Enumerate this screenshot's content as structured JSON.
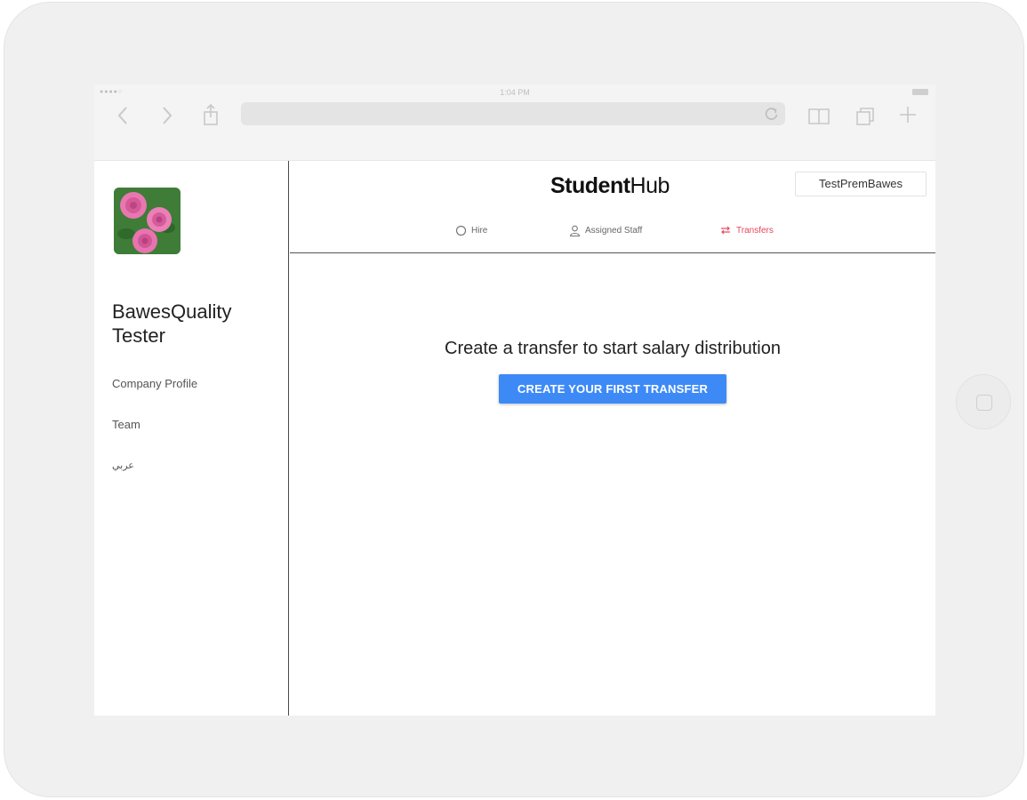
{
  "browser": {
    "status_time": "1:04 PM",
    "status_signal": "●●●●○",
    "icons": [
      "back-icon",
      "forward-icon",
      "share-icon",
      "reload-icon",
      "bookmarks-icon",
      "tabs-icon",
      "new-tab-icon"
    ]
  },
  "sidebar": {
    "company_name": "BawesQuality Tester",
    "links": [
      {
        "label": "Company Profile"
      },
      {
        "label": "Team"
      },
      {
        "label": "عربي"
      }
    ]
  },
  "header": {
    "logo_bold": "Student",
    "logo_light": "Hub",
    "user_label": "TestPremBawes",
    "tabs": [
      {
        "label": "Hire",
        "icon": "circle-icon",
        "active": false
      },
      {
        "label": "Assigned Staff",
        "icon": "person-icon",
        "active": false
      },
      {
        "label": "Transfers",
        "icon": "transfer-icon",
        "active": true
      }
    ]
  },
  "main": {
    "empty_message": "Create a transfer to start salary distribution",
    "cta_label": "CREATE YOUR FIRST TRANSFER"
  },
  "colors": {
    "accent": "#3d8af7",
    "active_tab": "#e8455e",
    "device_frame": "#f0f0f0"
  }
}
